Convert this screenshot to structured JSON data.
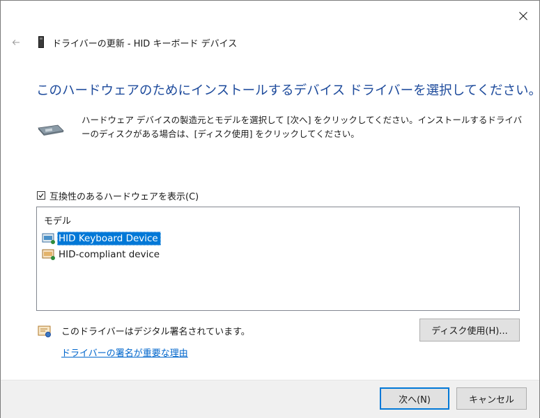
{
  "window": {
    "title": "ドライバーの更新 - HID キーボード デバイス",
    "close_icon": "close-icon",
    "back_icon": "back-arrow-icon"
  },
  "heading": "このハードウェアのためにインストールするデバイス ドライバーを選択してください。",
  "description": "ハードウェア デバイスの製造元とモデルを選択して [次へ] をクリックしてください。インストールするドライバーのディスクがある場合は、[ディスク使用] をクリックしてください。",
  "compatible_checkbox": {
    "label": "互換性のあるハードウェアを表示(C)",
    "checked": true
  },
  "model_list": {
    "header": "モデル",
    "items": [
      {
        "label": "HID Keyboard Device",
        "selected": true,
        "icon": "keyboard-device-icon"
      },
      {
        "label": "HID-compliant device",
        "selected": false,
        "icon": "hid-device-icon"
      }
    ]
  },
  "signature": {
    "text": "このドライバーはデジタル署名されています。",
    "link": "ドライバーの署名が重要な理由",
    "icon": "certificate-icon"
  },
  "buttons": {
    "have_disk": "ディスク使用(H)...",
    "next": "次へ(N)",
    "cancel": "キャンセル"
  },
  "colors": {
    "heading": "#1e4b9c",
    "selection": "#0078d7",
    "link": "#0066cc",
    "footer_bg": "#f0f0f0"
  }
}
